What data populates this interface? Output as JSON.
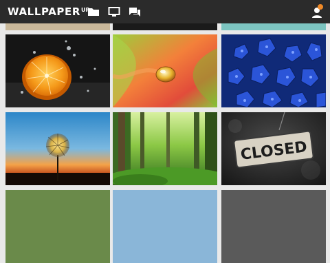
{
  "header": {
    "logo_main": "WALLPAPER",
    "logo_sup": "UP"
  },
  "icons": {
    "folder": "folder-icon",
    "screen": "monitor-icon",
    "chat": "chat-icon",
    "user": "user-icon",
    "notification_color": "#f08a28"
  },
  "wallpapers": [
    {
      "subject": "orange slice splash"
    },
    {
      "subject": "water droplet on petal"
    },
    {
      "subject": "blue hydrangea flowers"
    },
    {
      "subject": "dandelion at sunset"
    },
    {
      "subject": "green forest"
    },
    {
      "subject": "closed sign"
    }
  ],
  "sign_text": "CLOSED"
}
